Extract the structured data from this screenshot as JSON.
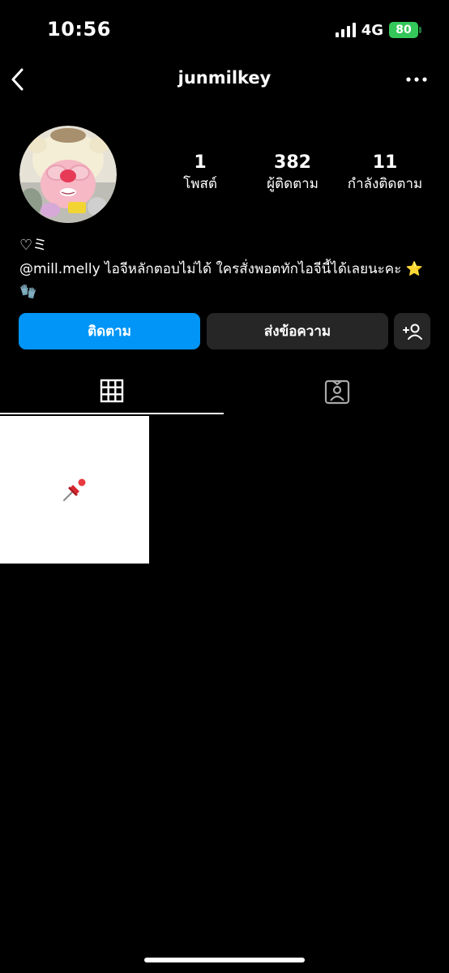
{
  "status_bar": {
    "time": "10:56",
    "network": "4G",
    "battery": "80"
  },
  "header": {
    "username": "junmilkey"
  },
  "profile": {
    "stats": {
      "posts_value": "1",
      "posts_label": "โพสต์",
      "followers_value": "382",
      "followers_label": "ผู้ติดตาม",
      "following_value": "11",
      "following_label": "กำลังติดตาม"
    },
    "bio_name": "♡ミ",
    "bio_mention": "@mill.melly",
    "bio_text": " ไอจีหลักตอบไม่ได้ ใครสั่งพอตทักไอจีนี้ได้เลยนะคะ ⭐️🧤"
  },
  "actions": {
    "follow_label": "ติดตาม",
    "message_label": "ส่งข้อความ"
  },
  "tabs": [
    {
      "name": "posts-grid",
      "icon": "grid-icon",
      "selected": true
    },
    {
      "name": "tagged",
      "icon": "tagged-person-icon",
      "selected": false
    }
  ],
  "posts": [
    {
      "icon": "pushpin-icon",
      "pinned": true
    }
  ],
  "colors": {
    "background": "#000000",
    "accent": "#0095f6",
    "secondary_button": "#262626",
    "battery": "#34c759"
  }
}
